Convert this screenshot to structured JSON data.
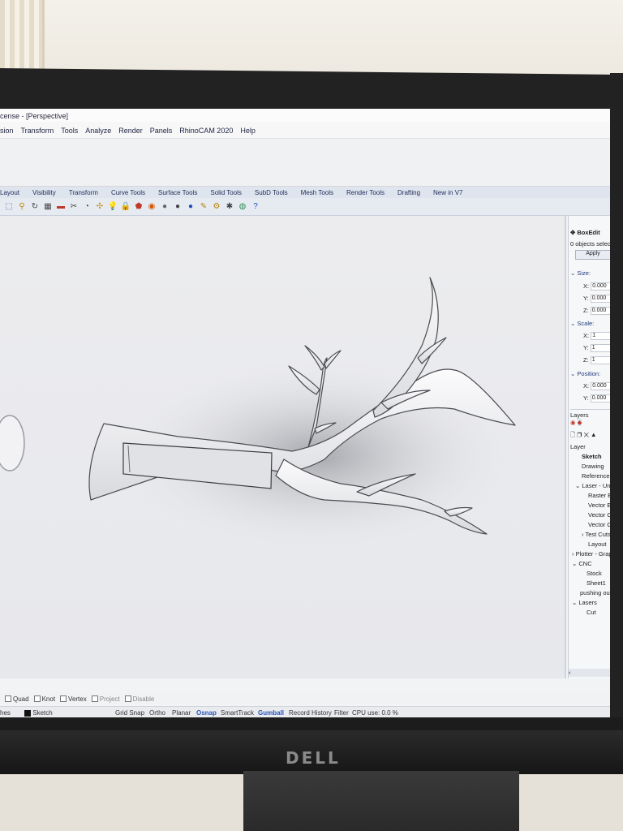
{
  "app": {
    "title": "cense - [Perspective]",
    "menu": [
      "sion",
      "Transform",
      "Tools",
      "Analyze",
      "Render",
      "Panels",
      "RhinoCAM 2020",
      "Help"
    ]
  },
  "toolbar_tabs": [
    "Layout",
    "Visibility",
    "Transform",
    "Curve Tools",
    "Surface Tools",
    "Solid Tools",
    "SubD Tools",
    "Mesh Tools",
    "Render Tools",
    "Drafting",
    "New in V7"
  ],
  "toolbar_icons": [
    "zoom-window-icon",
    "zoom-icon",
    "rotate-view-icon",
    "grid-icon",
    "car-icon",
    "split-icon",
    "rotate-icon",
    "move-icon",
    "light-bulb-icon",
    "lock-icon",
    "shield-icon",
    "color-wheel-icon",
    "material-sphere-icon",
    "render-sphere-icon",
    "blue-sphere-icon",
    "paint-icon",
    "gear-icon",
    "puzzle-icon",
    "globe-icon",
    "help-icon"
  ],
  "panel": {
    "boxedit_title": "BoxEdit",
    "selection_status": "0 objects selected",
    "apply_label": "Apply",
    "size_label": "Size:",
    "size": {
      "x": "0.000",
      "y": "0.000",
      "z": "0.000"
    },
    "scale_label": "Scale:",
    "scale": {
      "x": "1",
      "y": "1",
      "z": "1"
    },
    "position_label": "Position:",
    "position": {
      "x": "0.000",
      "y": "0.000"
    },
    "axis": {
      "x": "X:",
      "y": "Y:",
      "z": "Z:"
    },
    "layers_title": "Layers",
    "layer_header": "Layer",
    "layers": [
      "Sketch",
      "Drawing",
      "Reference Geo",
      "Laser - Universa",
      "Raster Engra",
      "Vector Etch",
      "Vector Cut -",
      "Vector Cut -",
      "Test Cuts",
      "Layout",
      "Plotter - Graphit",
      "CNC",
      "Stock",
      "Sheet1",
      "pushing out of f",
      "Lasers",
      "Cut"
    ]
  },
  "osnap": {
    "items": [
      "Quad",
      "Knot",
      "Vertex",
      "Project",
      "Disable"
    ]
  },
  "status": {
    "left": "hes",
    "layer": "Sketch",
    "toggles": [
      "Grid Snap",
      "Ortho",
      "Planar",
      "Osnap",
      "SmartTrack",
      "Gumball",
      "Record History",
      "Filter"
    ],
    "cpu": "CPU use: 0.0 %"
  },
  "monitor": {
    "brand": "DELL"
  },
  "colors": {
    "viewport_bg": "#e8e9ed",
    "tab_text": "#1d2a55",
    "active_toggle": "#2a56b8"
  }
}
